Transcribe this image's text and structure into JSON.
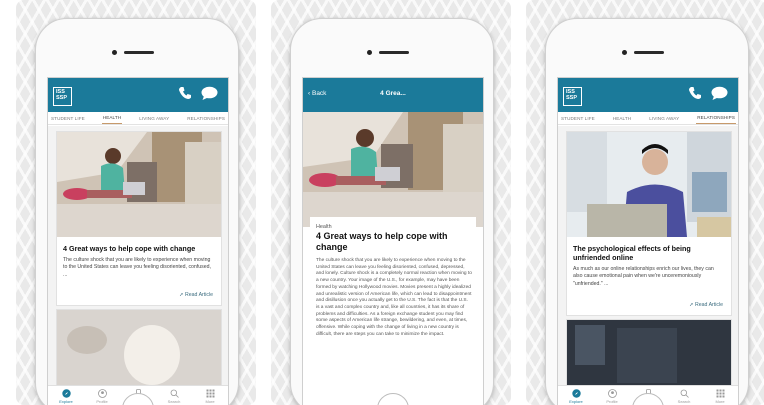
{
  "tabs": [
    "STUDENT LIFE",
    "HEALTH",
    "LIVING AWAY",
    "RELATIONSHIPS"
  ],
  "bottom_nav": [
    "Explore",
    "Profile",
    "Contact",
    "Search",
    "More"
  ],
  "logo_text": "ISS SSP",
  "read_more": "Read Article",
  "screen1": {
    "active_tab": "HEALTH",
    "card_title": "4 Great ways to help cope with change",
    "card_body": "The culture shock that you are likely to experience when moving to the United States can leave you feeling disoriented, confused, ..."
  },
  "screen2": {
    "back_label": "Back",
    "nav_title": "4 Grea...",
    "category": "Health",
    "title": "4 Great ways to help cope with change",
    "body": "The culture shock that you are likely to experience when moving to the United States can leave you feeling disoriented, confused, depressed, and lonely. Culture shock is a completely normal reaction when moving to a new country. Your image of the U.S., for example, may have been formed by watching Hollywood movies. Movies present a highly idealized and unrealistic version of American life, which can lead to disappointment and disillusion once you actually get to the U.S. The fact is that the U.S. is a vast and complex country and, like all countries, it has its share of problems and difficulties. As a foreign exchange student you may find some aspects of American life strange, bewildering, and even, at times, offensive. While coping with the change of living in a new country is difficult, there are steps you can take to minimize the impact."
  },
  "screen3": {
    "active_tab": "RELATIONSHIPS",
    "card_title": "The psychological effects of being unfriended online",
    "card_body": "As much as our online relationships enrich our lives, they can also cause emotional pain when we're unceremoniously \"unfriended.\" ..."
  },
  "colors": {
    "brand": "#1b7a9a",
    "tab_underline": "#c79a6b"
  }
}
